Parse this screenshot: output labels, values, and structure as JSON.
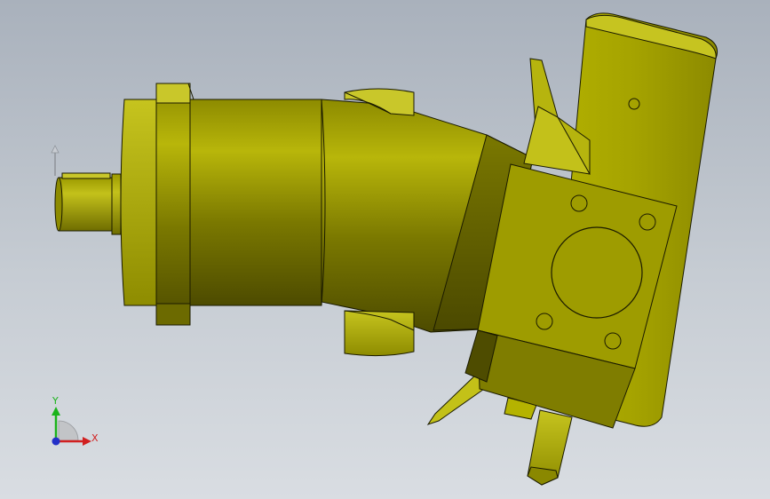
{
  "view": {
    "background_top": "#a9b1bc",
    "background_bottom": "#d9dde2"
  },
  "model": {
    "name": "",
    "body_color": "#a5a300",
    "highlight_color": "#c9c82a",
    "shadow_color": "#4f4d00",
    "edge_color": "#1a1a00"
  },
  "triad": {
    "y_label": "Y",
    "x_label": "X",
    "y_color": "#1bb31b",
    "x_color": "#d12020",
    "z_color": "#2330c8"
  }
}
